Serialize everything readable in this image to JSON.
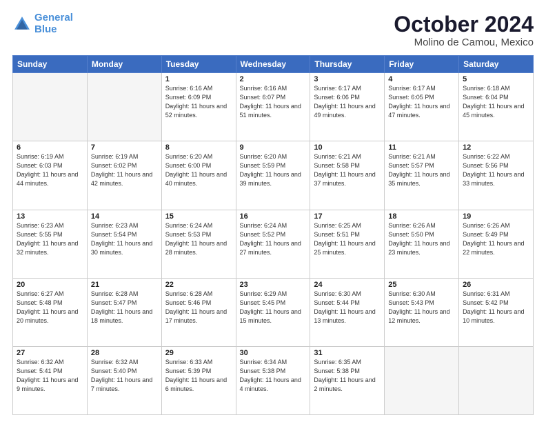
{
  "header": {
    "logo_line1": "General",
    "logo_line2": "Blue",
    "title": "October 2024",
    "subtitle": "Molino de Camou, Mexico"
  },
  "weekdays": [
    "Sunday",
    "Monday",
    "Tuesday",
    "Wednesday",
    "Thursday",
    "Friday",
    "Saturday"
  ],
  "weeks": [
    [
      {
        "day": "",
        "info": ""
      },
      {
        "day": "",
        "info": ""
      },
      {
        "day": "1",
        "info": "Sunrise: 6:16 AM\nSunset: 6:09 PM\nDaylight: 11 hours and 52 minutes."
      },
      {
        "day": "2",
        "info": "Sunrise: 6:16 AM\nSunset: 6:07 PM\nDaylight: 11 hours and 51 minutes."
      },
      {
        "day": "3",
        "info": "Sunrise: 6:17 AM\nSunset: 6:06 PM\nDaylight: 11 hours and 49 minutes."
      },
      {
        "day": "4",
        "info": "Sunrise: 6:17 AM\nSunset: 6:05 PM\nDaylight: 11 hours and 47 minutes."
      },
      {
        "day": "5",
        "info": "Sunrise: 6:18 AM\nSunset: 6:04 PM\nDaylight: 11 hours and 45 minutes."
      }
    ],
    [
      {
        "day": "6",
        "info": "Sunrise: 6:19 AM\nSunset: 6:03 PM\nDaylight: 11 hours and 44 minutes."
      },
      {
        "day": "7",
        "info": "Sunrise: 6:19 AM\nSunset: 6:02 PM\nDaylight: 11 hours and 42 minutes."
      },
      {
        "day": "8",
        "info": "Sunrise: 6:20 AM\nSunset: 6:00 PM\nDaylight: 11 hours and 40 minutes."
      },
      {
        "day": "9",
        "info": "Sunrise: 6:20 AM\nSunset: 5:59 PM\nDaylight: 11 hours and 39 minutes."
      },
      {
        "day": "10",
        "info": "Sunrise: 6:21 AM\nSunset: 5:58 PM\nDaylight: 11 hours and 37 minutes."
      },
      {
        "day": "11",
        "info": "Sunrise: 6:21 AM\nSunset: 5:57 PM\nDaylight: 11 hours and 35 minutes."
      },
      {
        "day": "12",
        "info": "Sunrise: 6:22 AM\nSunset: 5:56 PM\nDaylight: 11 hours and 33 minutes."
      }
    ],
    [
      {
        "day": "13",
        "info": "Sunrise: 6:23 AM\nSunset: 5:55 PM\nDaylight: 11 hours and 32 minutes."
      },
      {
        "day": "14",
        "info": "Sunrise: 6:23 AM\nSunset: 5:54 PM\nDaylight: 11 hours and 30 minutes."
      },
      {
        "day": "15",
        "info": "Sunrise: 6:24 AM\nSunset: 5:53 PM\nDaylight: 11 hours and 28 minutes."
      },
      {
        "day": "16",
        "info": "Sunrise: 6:24 AM\nSunset: 5:52 PM\nDaylight: 11 hours and 27 minutes."
      },
      {
        "day": "17",
        "info": "Sunrise: 6:25 AM\nSunset: 5:51 PM\nDaylight: 11 hours and 25 minutes."
      },
      {
        "day": "18",
        "info": "Sunrise: 6:26 AM\nSunset: 5:50 PM\nDaylight: 11 hours and 23 minutes."
      },
      {
        "day": "19",
        "info": "Sunrise: 6:26 AM\nSunset: 5:49 PM\nDaylight: 11 hours and 22 minutes."
      }
    ],
    [
      {
        "day": "20",
        "info": "Sunrise: 6:27 AM\nSunset: 5:48 PM\nDaylight: 11 hours and 20 minutes."
      },
      {
        "day": "21",
        "info": "Sunrise: 6:28 AM\nSunset: 5:47 PM\nDaylight: 11 hours and 18 minutes."
      },
      {
        "day": "22",
        "info": "Sunrise: 6:28 AM\nSunset: 5:46 PM\nDaylight: 11 hours and 17 minutes."
      },
      {
        "day": "23",
        "info": "Sunrise: 6:29 AM\nSunset: 5:45 PM\nDaylight: 11 hours and 15 minutes."
      },
      {
        "day": "24",
        "info": "Sunrise: 6:30 AM\nSunset: 5:44 PM\nDaylight: 11 hours and 13 minutes."
      },
      {
        "day": "25",
        "info": "Sunrise: 6:30 AM\nSunset: 5:43 PM\nDaylight: 11 hours and 12 minutes."
      },
      {
        "day": "26",
        "info": "Sunrise: 6:31 AM\nSunset: 5:42 PM\nDaylight: 11 hours and 10 minutes."
      }
    ],
    [
      {
        "day": "27",
        "info": "Sunrise: 6:32 AM\nSunset: 5:41 PM\nDaylight: 11 hours and 9 minutes."
      },
      {
        "day": "28",
        "info": "Sunrise: 6:32 AM\nSunset: 5:40 PM\nDaylight: 11 hours and 7 minutes."
      },
      {
        "day": "29",
        "info": "Sunrise: 6:33 AM\nSunset: 5:39 PM\nDaylight: 11 hours and 6 minutes."
      },
      {
        "day": "30",
        "info": "Sunrise: 6:34 AM\nSunset: 5:38 PM\nDaylight: 11 hours and 4 minutes."
      },
      {
        "day": "31",
        "info": "Sunrise: 6:35 AM\nSunset: 5:38 PM\nDaylight: 11 hours and 2 minutes."
      },
      {
        "day": "",
        "info": ""
      },
      {
        "day": "",
        "info": ""
      }
    ]
  ]
}
